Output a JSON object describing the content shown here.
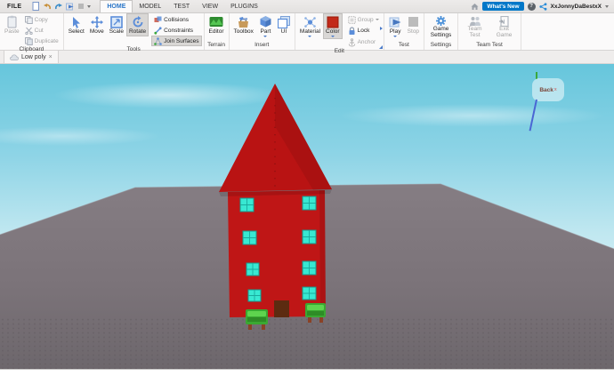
{
  "menu": {
    "file": "FILE",
    "tabs": [
      "HOME",
      "MODEL",
      "TEST",
      "VIEW",
      "PLUGINS"
    ],
    "active_tab": "HOME"
  },
  "topright": {
    "whats_new": "What's New",
    "help": "?",
    "username": "XxJonnyDaBestxX"
  },
  "ribbon": {
    "clipboard": {
      "label": "Clipboard",
      "paste": "Paste",
      "copy": "Copy",
      "cut": "Cut",
      "duplicate": "Duplicate"
    },
    "tools": {
      "label": "Tools",
      "select": "Select",
      "move": "Move",
      "scale": "Scale",
      "rotate": "Rotate",
      "collisions": "Collisions",
      "constraints": "Constraints",
      "join_surfaces": "Join Surfaces"
    },
    "terrain": {
      "label": "Terrain",
      "editor": "Editor"
    },
    "insert": {
      "label": "Insert",
      "toolbox": "Toolbox",
      "part": "Part",
      "ui": "UI"
    },
    "edit": {
      "label": "Edit",
      "material": "Material",
      "color": "Color",
      "group": "Group",
      "lock": "Lock",
      "anchor": "Anchor"
    },
    "test": {
      "label": "Test",
      "play": "Play",
      "stop": "Stop"
    },
    "settings": {
      "label": "Settings",
      "game_settings": "Game Settings"
    },
    "team_test": {
      "label": "Team Test",
      "team_test": "Team Test",
      "exit_game": "Exit Game"
    }
  },
  "doc_tab": {
    "title": "Low poly",
    "close": "×"
  },
  "viewport": {
    "view_selector_label": "Back",
    "view_selector_axis": "x"
  },
  "colors": {
    "accent_blue": "#2a76c8",
    "whats_new_bg": "#0077c8",
    "selected_button_bg": "#d9d7d5",
    "sky_top": "#66c6dc",
    "sky_horizon": "#dcf2f7",
    "baseplate_gray": "#7b7379",
    "house_red": "#bf1616",
    "window_teal": "#38e8d2",
    "door_brown": "#5c2b10",
    "bench_green": "#42b838"
  }
}
